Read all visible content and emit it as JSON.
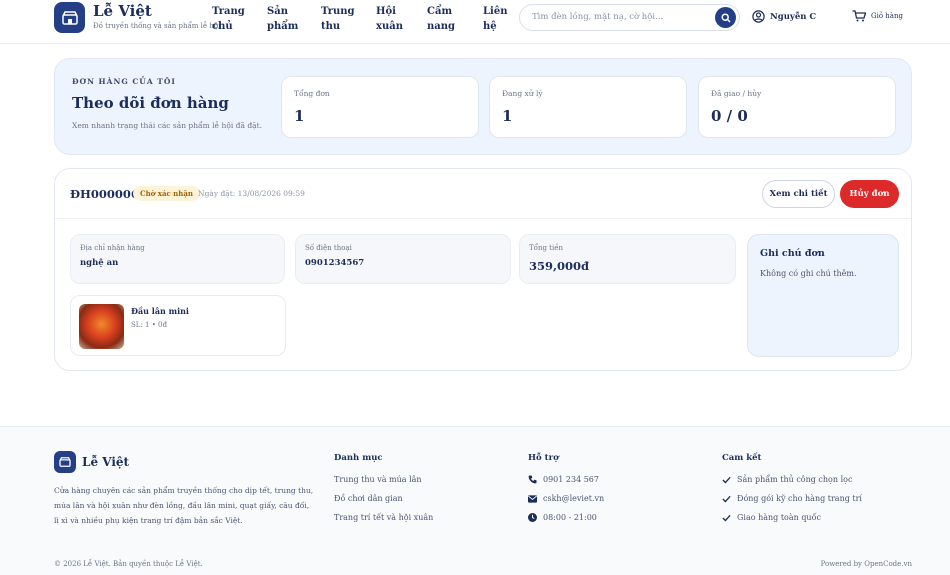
{
  "header": {
    "brand_name": "Lễ Việt",
    "brand_tagline": "Đồ truyền thống và sản phẩm lễ hội",
    "nav": [
      {
        "line1": "Trang",
        "line2": "chủ"
      },
      {
        "line1": "Sản",
        "line2": "phẩm"
      },
      {
        "line1": "Trung",
        "line2": "thu"
      },
      {
        "line1": "Hội",
        "line2": "xuân"
      },
      {
        "line1": "Cẩm",
        "line2": "nang"
      },
      {
        "line1": "Liên",
        "line2": "hệ"
      }
    ],
    "search_placeholder": "Tìm đèn lồng, mặt nạ, cờ hội...",
    "user_name": "Nguyễn C",
    "cart_label": "Giỏ hàng"
  },
  "summary": {
    "eyebrow": "ĐƠN HÀNG CỦA TÔI",
    "title": "Theo dõi đơn hàng",
    "subtitle": "Xem nhanh trạng thái các sản phẩm lễ hội đã đặt.",
    "stats": [
      {
        "label": "Tổng đơn",
        "value": "1"
      },
      {
        "label": "Đang xử lý",
        "value": "1"
      },
      {
        "label": "Đã giao / hủy",
        "value": "0 / 0"
      }
    ]
  },
  "order": {
    "code": "ĐH000006",
    "status": "Chờ xác nhận",
    "date": "Ngày đặt: 13/08/2026 09:59",
    "detail_button": "Xem chi tiết",
    "cancel_button": "Hủy đơn",
    "address_label": "Địa chỉ nhận hàng",
    "address_value": "nghệ an",
    "phone_label": "Số điện thoại",
    "phone_value": "0901234567",
    "total_label": "Tổng tiền",
    "total_value": "359,000đ",
    "note_title": "Ghi chú đơn",
    "note_text": "Không có ghi chú thêm.",
    "item": {
      "name": "Đầu lân mini",
      "meta": "SL: 1 • 0đ"
    }
  },
  "footer": {
    "brand": "Lễ Việt",
    "description": "Cửa hàng chuyên các sản phẩm truyền thống cho dịp tết, trung thu, múa lân và hội xuân như đèn lồng, đầu lân mini, quạt giấy, câu đối, lì xì và nhiều phụ kiện trang trí đậm bản sắc Việt.",
    "categories_title": "Danh mục",
    "categories": [
      "Trung thu và múa lân",
      "Đồ chơi dân gian",
      "Trang trí tết và hội xuân"
    ],
    "support_title": "Hỗ trợ",
    "support": {
      "phone": "0901 234 567",
      "email": "cskh@leviet.vn",
      "hours": "08:00 - 21:00"
    },
    "commit_title": "Cam kết",
    "commitments": [
      "Sản phẩm thủ công chọn lọc",
      "Đóng gói kỹ cho hàng trang trí",
      "Giao hàng toàn quốc"
    ],
    "copyright": "© 2026 Lễ Việt. Bản quyền thuộc Lễ Việt.",
    "powered": "Powered by OpenCode.vn"
  },
  "colors": {
    "primary": "#243f85",
    "danger": "#dc2a2a",
    "panel": "#eef4fd",
    "badge_bg": "#fdf3d8"
  }
}
